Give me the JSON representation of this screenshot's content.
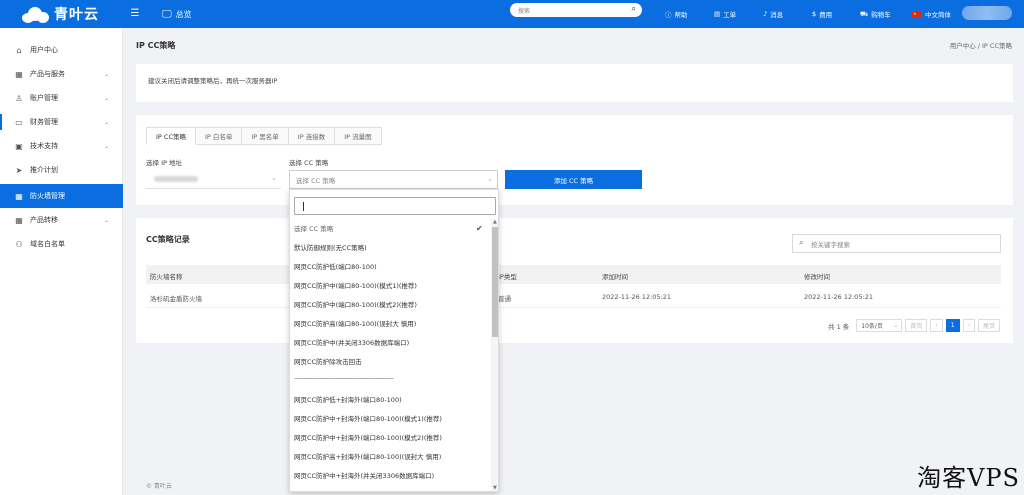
{
  "header": {
    "brand": "青叶云",
    "overview": "总览",
    "search_placeholder": "搜索",
    "links": [
      {
        "label": "帮助",
        "icon": "help-icon"
      },
      {
        "label": "工单",
        "icon": "ticket-icon"
      },
      {
        "label": "消息",
        "icon": "bell-icon"
      },
      {
        "label": "费用",
        "icon": "money-icon"
      },
      {
        "label": "购物车",
        "icon": "cart-icon"
      },
      {
        "label": "中文简体",
        "icon": "flag-cn-icon"
      }
    ]
  },
  "sidebar": {
    "items": [
      {
        "label": "用户中心",
        "icon": "home-icon"
      },
      {
        "label": "产品与服务",
        "icon": "grid-icon",
        "expandable": true
      },
      {
        "label": "账户管理",
        "icon": "user-icon",
        "expandable": true
      },
      {
        "label": "财务管理",
        "icon": "wallet-icon",
        "expandable": true
      },
      {
        "label": "技术支持",
        "icon": "support-icon",
        "expandable": true
      },
      {
        "label": "推介计划",
        "icon": "send-icon"
      },
      {
        "label": "防火墙管理",
        "icon": "grid-icon",
        "active": true
      },
      {
        "label": "产品转移",
        "icon": "grid-icon",
        "expandable": true
      },
      {
        "label": "域名白名单",
        "icon": "users-icon"
      }
    ]
  },
  "page": {
    "title": "IP CC策略",
    "breadcrumb": "用户中心 / IP CC策略",
    "notice": "建议关闭后请调整策略后，再统一次服务器IP"
  },
  "form": {
    "tabs": [
      "IP CC策略",
      "IP 白名单",
      "IP 黑名单",
      "IP 连接数",
      "IP 流量图"
    ],
    "ip_label": "选择 IP 地址",
    "cc_label": "选择 CC 策略",
    "cc_placeholder": "选择 CC 策略",
    "add_button": "添加 CC 策略"
  },
  "records": {
    "title": "CC策略记录",
    "search_placeholder": "按关键字搜索",
    "columns": [
      "防火墙名称",
      "IP类型",
      "添加时间",
      "修改时间"
    ],
    "rows": [
      {
        "name": "洛杉矶金盾防火墙",
        "ip_type": "普通",
        "created": "2022-11-26 12:05:21",
        "modified": "2022-11-26 12:05:21"
      }
    ],
    "pager": {
      "total": "共 1 条",
      "size": "10条/页",
      "prev": "首页",
      "page": "1",
      "next": "尾页"
    }
  },
  "dropdown": {
    "options": [
      "选择 CC 策略",
      "默认防御规则(无CC策略)",
      "网页CC防护低(端口80-100)",
      "网页CC防护中(端口80-100)(模式1)(推荐)",
      "网页CC防护中(端口80-100)(模式2)(推荐)",
      "网页CC防护高(端口80-100)(误封大 慎用)",
      "网页CC防护中(并关闭3306数据库端口)",
      "网页CC防护除攻击回击",
      "——————————————————",
      "网页CC防护低+封海外(端口80-100)",
      "网页CC防护中+封海外(端口80-100)(模式1)(推荐)",
      "网页CC防护中+封海外(端口80-100)(模式2)(推荐)",
      "网页CC防护高+封海外(端口80-100)(误封大 慎用)",
      "网页CC防护中+封海外(并关闭3306数据库端口)"
    ]
  },
  "footer": "© 青叶云",
  "watermark": "淘客VPS",
  "colors": {
    "primary": "#0a6ee0"
  }
}
